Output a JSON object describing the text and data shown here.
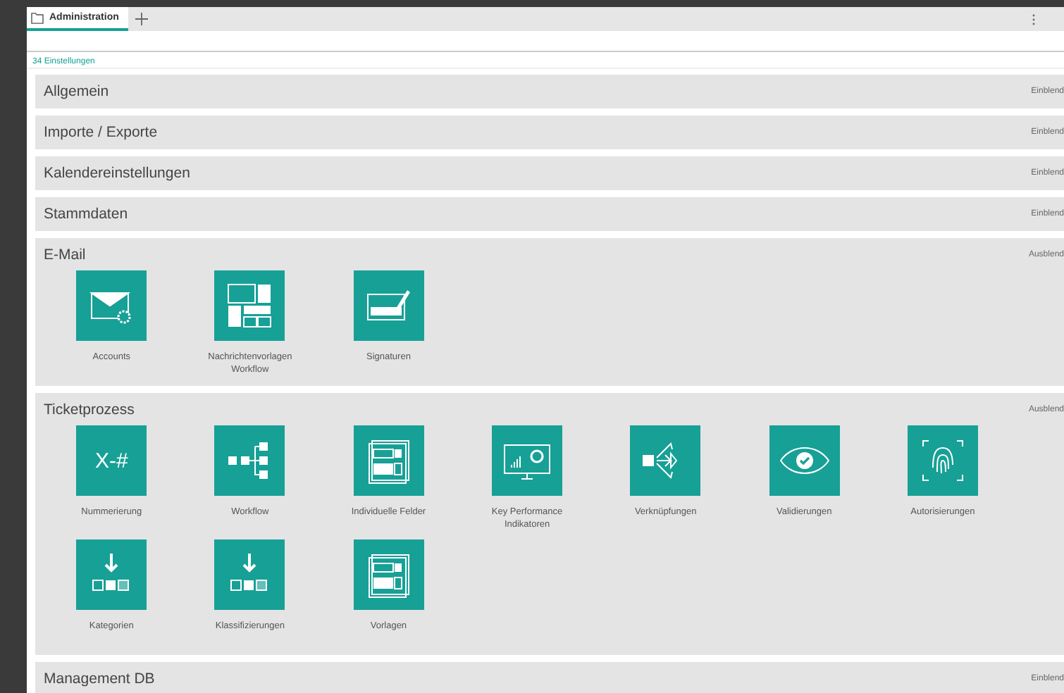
{
  "tabs": [
    {
      "label": "Administration",
      "selected": true
    }
  ],
  "count": "34 Einstellungen",
  "sections": [
    {
      "title": "Allgemein",
      "toggle": "Einblend",
      "expanded": false
    },
    {
      "title": "Importe / Exporte",
      "toggle": "Einblend",
      "expanded": false
    },
    {
      "title": "Kalendereinstellungen",
      "toggle": "Einblend",
      "expanded": false
    },
    {
      "title": "Stammdaten",
      "toggle": "Einblend",
      "expanded": false
    },
    {
      "title": "E-Mail",
      "toggle": "Ausblend",
      "expanded": true,
      "tiles": [
        {
          "label": "Accounts",
          "kind": "mail"
        },
        {
          "label": "Nachrichtenvorlagen Workflow",
          "kind": "layout"
        },
        {
          "label": "Signaturen",
          "kind": "signature"
        }
      ]
    },
    {
      "title": "Ticketprozess",
      "toggle": "Ausblend",
      "expanded": true,
      "tiles": [
        {
          "label": "Nummerierung",
          "kind": "glyph",
          "glyph": "X-#"
        },
        {
          "label": "Workflow",
          "kind": "workflow"
        },
        {
          "label": "Individuelle Felder",
          "kind": "form"
        },
        {
          "label": "Key Performance Indikatoren",
          "kind": "monitor"
        },
        {
          "label": "Verknüpfungen",
          "kind": "branch"
        },
        {
          "label": "Validierungen",
          "kind": "eye"
        },
        {
          "label": "Autorisierungen",
          "kind": "fingerprint"
        },
        {
          "label": "Kategorien",
          "kind": "download"
        },
        {
          "label": "Klassifizierungen",
          "kind": "download"
        },
        {
          "label": "Vorlagen",
          "kind": "form"
        }
      ]
    },
    {
      "title": "Management DB",
      "toggle": "Einblend",
      "expanded": false
    }
  ]
}
